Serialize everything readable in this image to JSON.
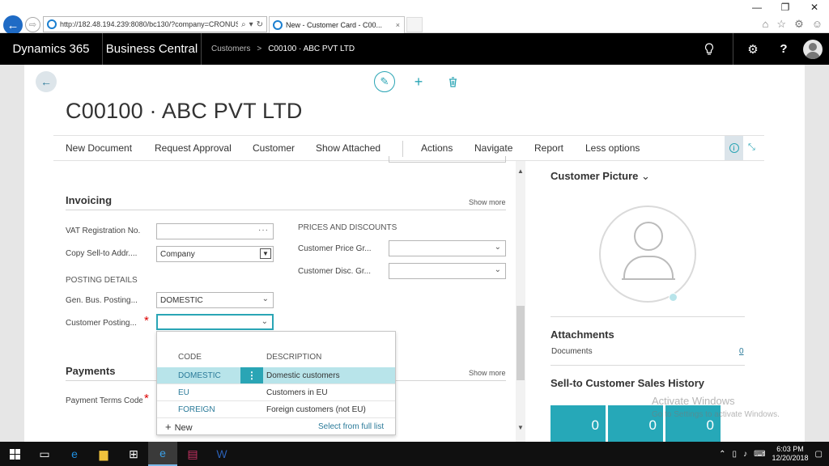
{
  "browser": {
    "url": "http://182.48.194.239:8080/bc130/?company=CRONUS",
    "tab_title": "New - Customer Card - C00...",
    "tab_close": "×"
  },
  "topbar": {
    "brand": "Dynamics 365",
    "product": "Business Central",
    "breadcrumb_parent": "Customers",
    "breadcrumb_sep": ">",
    "breadcrumb_current": "C00100 · ABC PVT LTD"
  },
  "page": {
    "title": "C00100 · ABC PVT LTD"
  },
  "actionbar": {
    "items": [
      "New Document",
      "Request Approval",
      "Customer",
      "Show Attached",
      "Actions",
      "Navigate",
      "Report",
      "Less options"
    ]
  },
  "invoicing": {
    "title": "Invoicing",
    "show_more": "Show more",
    "vat_label": "VAT Registration No.",
    "vat_value": "",
    "copy_label": "Copy Sell-to Addr....",
    "copy_value": "Company",
    "posting_details": "POSTING DETAILS",
    "gen_bus_label": "Gen. Bus. Posting...",
    "gen_bus_value": "DOMESTIC",
    "cust_posting_label": "Customer Posting...",
    "cust_posting_value": "",
    "prices_discounts": "PRICES AND DISCOUNTS",
    "cust_price_label": "Customer Price Gr...",
    "cust_price_value": "",
    "cust_disc_label": "Customer Disc. Gr...",
    "cust_disc_value": ""
  },
  "lookup": {
    "col_code": "CODE",
    "col_desc": "DESCRIPTION",
    "rows": [
      {
        "code": "DOMESTIC",
        "desc": "Domestic customers"
      },
      {
        "code": "EU",
        "desc": "Customers in EU"
      },
      {
        "code": "FOREIGN",
        "desc": "Foreign customers (not EU)"
      }
    ],
    "new_label": "New",
    "full_list": "Select from full list"
  },
  "payments": {
    "title": "Payments",
    "show_more": "Show more",
    "terms_label": "Payment Terms Code"
  },
  "factbox": {
    "picture_title": "Customer Picture",
    "attachments_title": "Attachments",
    "documents_label": "Documents",
    "documents_value": "0",
    "history_title": "Sell-to Customer Sales History",
    "tiles": [
      "0",
      "0",
      "0"
    ]
  },
  "watermark": {
    "line1": "Activate Windows",
    "line2": "Go to Settings to activate Windows."
  },
  "taskbar": {
    "time": "6:03 PM",
    "date": "12/20/2018"
  },
  "colors": {
    "accent": "#2aa5b5",
    "selected_row": "#b8e4ea",
    "required": "#dd0000",
    "topbar": "#000000"
  }
}
